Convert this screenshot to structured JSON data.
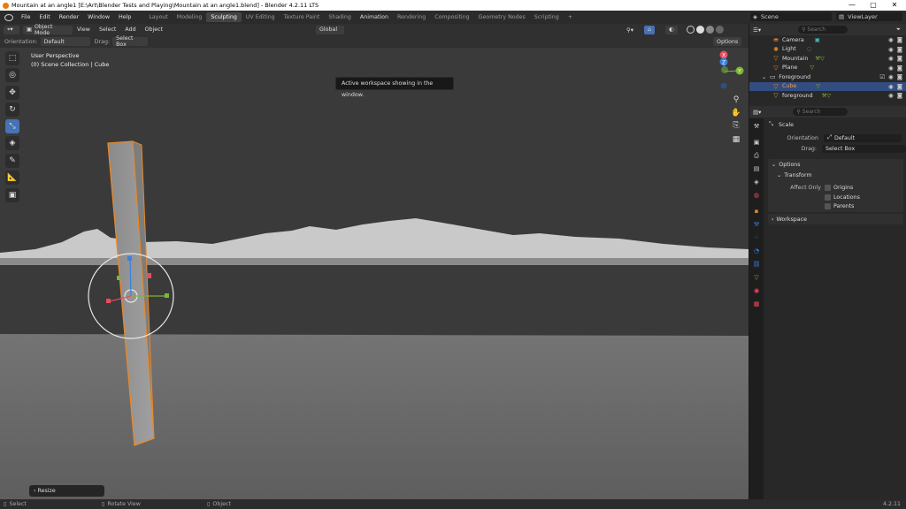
{
  "titlebar": {
    "title": "Mountain at an angle1 [E:\\Art\\Blender Tests and Playing\\Mountain at an angle1.blend] - Blender 4.2.11 LTS",
    "minimize": "—",
    "maximize": "▢",
    "close": "✕"
  },
  "menu": {
    "items": [
      "File",
      "Edit",
      "Render",
      "Window",
      "Help"
    ]
  },
  "workspaces": [
    "Layout",
    "Modeling",
    "Sculpting",
    "UV Editing",
    "Texture Paint",
    "Shading",
    "Animation",
    "Rendering",
    "Compositing",
    "Geometry Nodes",
    "Scripting",
    "+"
  ],
  "active_workspace": "Sculpting",
  "scene": {
    "label": "Scene"
  },
  "view_layer": {
    "label": "ViewLayer"
  },
  "header": {
    "mode": "Object Mode",
    "view": "View",
    "select": "Select",
    "add": "Add",
    "object": "Object",
    "transform_orientation": "Global"
  },
  "toolheader": {
    "orientation_label": "Orientation:",
    "orientation_value": "Default",
    "drag_label": "Drag:",
    "drag_value": "Select Box",
    "options": "Options"
  },
  "tooltip": "Active workspace showing in the window.",
  "viewport": {
    "perspective": "User Perspective",
    "collection": "(0) Scene Collection | Cube"
  },
  "gizmo_axes": {
    "x": "X",
    "y": "Y",
    "z": "Z"
  },
  "operator_panel": "Resize",
  "outliner": {
    "search_placeholder": "Search",
    "rows": [
      {
        "name": "Camera",
        "icon": "camera-icon"
      },
      {
        "name": "Light",
        "icon": "light-icon"
      },
      {
        "name": "Mountain",
        "icon": "mesh-icon"
      },
      {
        "name": "Plane",
        "icon": "mesh-icon"
      },
      {
        "name": "Foreground",
        "icon": "collection-icon"
      },
      {
        "name": "Cube",
        "icon": "mesh-icon"
      },
      {
        "name": "foreground",
        "icon": "mesh-icon"
      }
    ]
  },
  "properties": {
    "search_placeholder": "Search",
    "tool_name": "Scale",
    "orientation_label": "Orientation",
    "orientation_value": "Default",
    "drag_label": "Drag:",
    "drag_value": "Select Box",
    "options_panel": "Options",
    "transform_panel": "Transform",
    "affect_only": "Affect Only",
    "origins": "Origins",
    "locations": "Locations",
    "parents": "Parents",
    "workspace_panel": "Workspace"
  },
  "statusbar": {
    "select": "Select",
    "rotate_view": "Rotate View",
    "object": "Object",
    "version": "4.2.11"
  },
  "colors": {
    "accent": "#4772b3",
    "selection": "#e8892a",
    "x_axis": "#e84d5d",
    "y_axis": "#7fb534",
    "z_axis": "#3b7fe0"
  }
}
